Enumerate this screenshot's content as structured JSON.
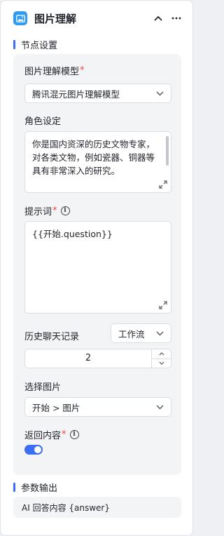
{
  "header": {
    "title": "图片理解",
    "node_icon": "image-icon",
    "collapse_icon": "chevron-up-icon",
    "more_icon": "more-icon"
  },
  "node_settings": {
    "section_title": "节点设置",
    "model": {
      "label": "图片理解模型",
      "required_mark": "*",
      "value": "腾讯混元图片理解模型"
    },
    "role": {
      "label": "角色设定",
      "value": "你是国内资深的历史文物专家，对各类文物，例如瓷器、铜器等具有非常深入的研究。"
    },
    "prompt": {
      "label": "提示词",
      "required_mark": "*",
      "value": "{{开始.question}}"
    },
    "history": {
      "label": "历史聊天记录",
      "mode_value": "工作流",
      "count": "2"
    },
    "image": {
      "label": "选择图片",
      "value": "开始 > 图片"
    },
    "return_content": {
      "label": "返回内容",
      "required_mark": "*",
      "enabled": true
    }
  },
  "output": {
    "section_title": "参数输出",
    "item": "AI 回答内容 {answer}"
  },
  "colors": {
    "accent": "#3b6ef5",
    "node_icon_bg": "#2f9cf4",
    "required": "#f0463c"
  }
}
